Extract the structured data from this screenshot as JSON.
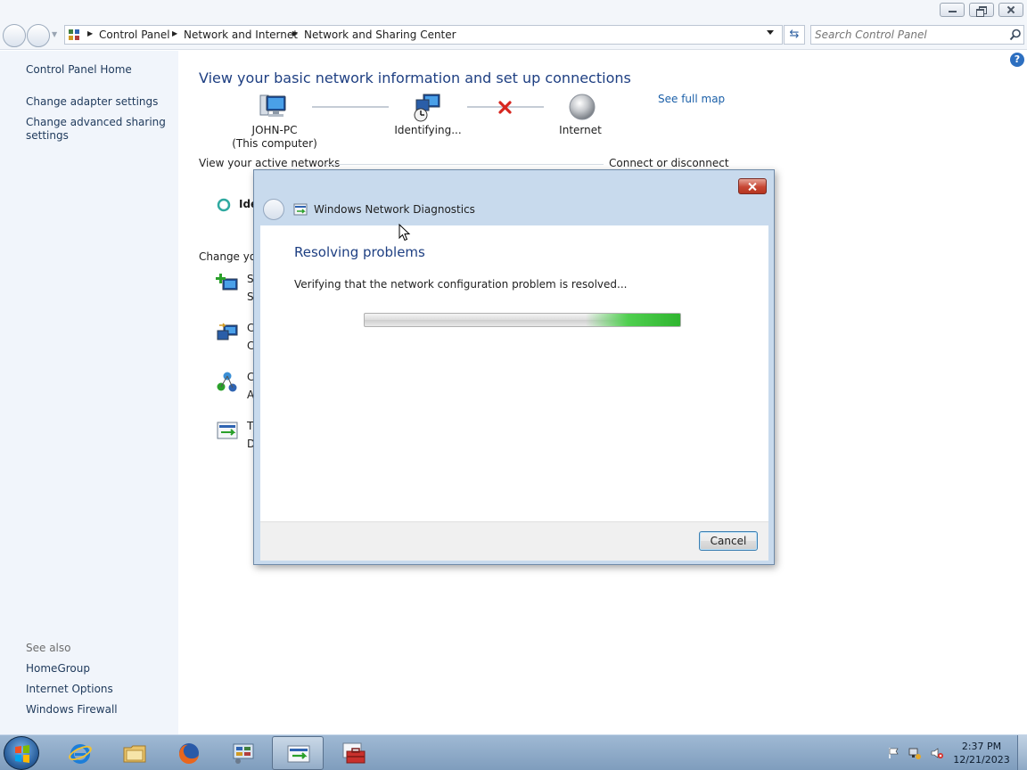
{
  "breadcrumb": [
    "Control Panel",
    "Network and Internet",
    "Network and Sharing Center"
  ],
  "search": {
    "placeholder": "Search Control Panel"
  },
  "sidebar": {
    "home": "Control Panel Home",
    "links": [
      "Change adapter settings",
      "Change advanced sharing\nsettings"
    ],
    "see_also_label": "See also",
    "see_also": [
      "HomeGroup",
      "Internet Options",
      "Windows Firewall"
    ]
  },
  "main": {
    "heading": "View your basic network information and set up connections",
    "see_full_map": "See full map",
    "computer_name": "JOHN-PC",
    "computer_sub": "(This computer)",
    "network_name": "Identifying...",
    "internet_label": "Internet",
    "active_networks_label": "View your active networks",
    "connect_disconnect": "Connect or disconnect",
    "active_network_partial": "Ide",
    "change_settings_partial": "Change you",
    "task_initials": [
      {
        "title": "S",
        "desc": "S"
      },
      {
        "title": "C",
        "desc": "C"
      },
      {
        "title": "C",
        "desc": "A"
      },
      {
        "title": "T",
        "desc": "D"
      }
    ]
  },
  "dialog": {
    "title": "Windows Network Diagnostics",
    "heading": "Resolving problems",
    "message": "Verifying that the network configuration problem is resolved...",
    "cancel": "Cancel"
  },
  "taskbar": {
    "time": "2:37 PM",
    "date": "12/21/2023",
    "apps": [
      "internet-explorer",
      "windows-explorer",
      "firefox",
      "control-panel",
      "network-diagnostics",
      "toolbox"
    ]
  },
  "colors": {
    "link": "#1a5fa8",
    "heading": "#1e3f82",
    "left_pane": "#f1f5fb",
    "progress_green": "#2fb52f",
    "error_red": "#d7261f"
  }
}
